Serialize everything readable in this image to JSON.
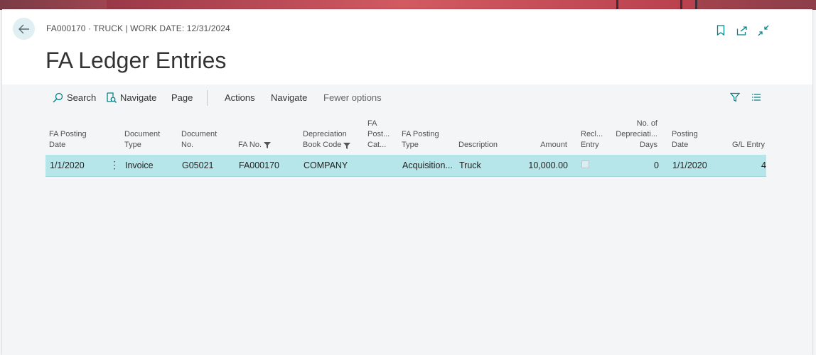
{
  "header": {
    "breadcrumb": "FA000170 · TRUCK | WORK DATE: 12/31/2024",
    "title": "FA Ledger Entries"
  },
  "actions": {
    "search": "Search",
    "navigate_icon_label": "Navigate",
    "page": "Page",
    "actions": "Actions",
    "navigate": "Navigate",
    "fewer_options": "Fewer options"
  },
  "icons": {
    "back": "arrow-left-icon",
    "bookmark": "bookmark-icon",
    "share": "share-icon",
    "collapse": "collapse-icon",
    "search": "search-icon",
    "navigate": "find-entries-icon",
    "filter": "filter-icon",
    "list": "list-view-icon"
  },
  "colors": {
    "accent": "#008489",
    "row_highlight": "#b7e6ea"
  },
  "table": {
    "columns": [
      "FA Posting\nDate",
      "Document\nType",
      "Document\nNo.",
      "FA No.",
      "Depreciation\nBook Code",
      "FA\nPost...\nCat...",
      "FA Posting\nType",
      "Description",
      "Amount",
      "Recl...\nEntry",
      "No. of\nDepreciati...\nDays",
      "Posting\nDate",
      "G/L Entry"
    ],
    "rows": [
      {
        "fa_posting_date": "1/1/2020",
        "document_type": "Invoice",
        "document_no": "G05021",
        "fa_no": "FA000170",
        "depreciation_book_code": "COMPANY",
        "fa_posting_category": "",
        "fa_posting_type": "Acquisition...",
        "description": "Truck",
        "amount": "10,000.00",
        "reclassification_entry": false,
        "no_of_depreciation_days": "0",
        "posting_date": "1/1/2020",
        "gl_entry_no": "4"
      }
    ]
  }
}
